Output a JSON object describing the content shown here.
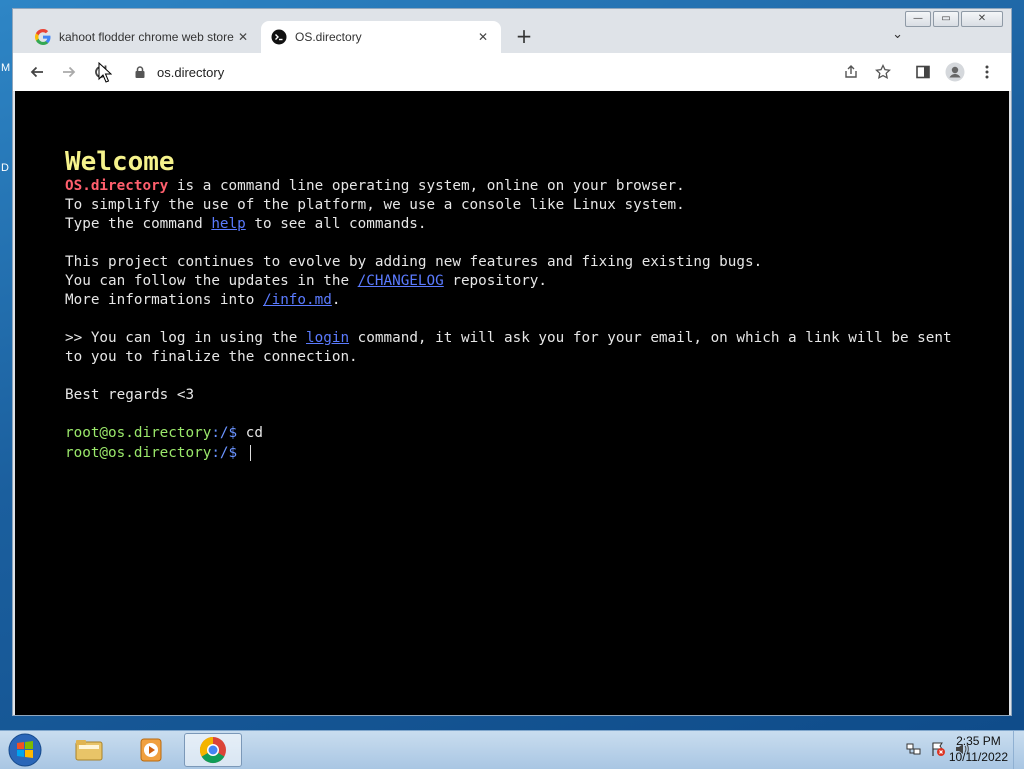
{
  "desktop": {
    "edge_letters": [
      "M",
      "D"
    ]
  },
  "window": {
    "controls": {
      "minimize": "—",
      "maximize": "▭",
      "close": "✕"
    }
  },
  "tabs": [
    {
      "title": "kahoot flodder chrome web store",
      "icon": "google-icon",
      "active": false
    },
    {
      "title": "OS.directory",
      "icon": "terminal-icon",
      "active": true
    }
  ],
  "tab_close_glyph": "✕",
  "new_tab_glyph": "+",
  "tab_search_glyph": "⌄",
  "toolbar": {
    "url": "os.directory"
  },
  "terminal": {
    "welcome": "Welcome",
    "intro": {
      "brand": "OS.directory",
      "line1_rest": " is a command line operating system, online on your browser.",
      "line2": "To simplify the use of the platform, we use a console like Linux system.",
      "line3_pre": "Type the command ",
      "line3_link": "help",
      "line3_post": " to see all commands."
    },
    "project": {
      "line1": "This project continues to evolve by adding new features and fixing existing bugs.",
      "line2_pre": "You can follow the updates in the ",
      "line2_link": "/CHANGELOG",
      "line2_post": " repository.",
      "line3_pre": "More informations into ",
      "line3_link": "/info.md",
      "line3_post": "."
    },
    "login": {
      "pre": ">> You can log in using the ",
      "link": "login",
      "post": " command, it will ask you for your email, on which a link will be sent to you to finalize the connection."
    },
    "regards": "Best regards <3",
    "history": [
      {
        "user": "root@os.directory",
        "path": ":/",
        "symbol": "$",
        "command": "cd"
      },
      {
        "user": "root@os.directory",
        "path": ":/",
        "symbol": "$",
        "command": ""
      }
    ]
  },
  "taskbar": {
    "time": "2:35 PM",
    "date": "10/11/2022"
  }
}
